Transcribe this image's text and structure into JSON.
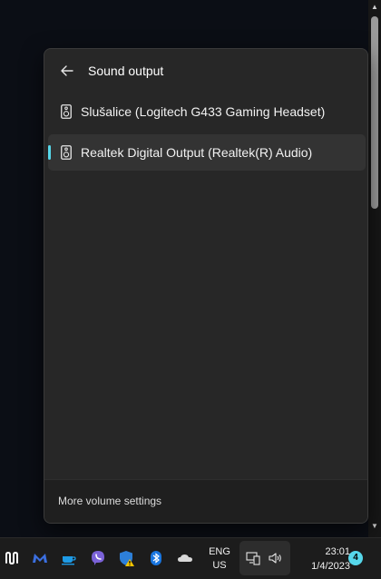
{
  "flyout": {
    "title": "Sound output",
    "devices": [
      {
        "label": "Slušalice (Logitech G433 Gaming Headset)",
        "selected": false
      },
      {
        "label": "Realtek Digital Output (Realtek(R) Audio)",
        "selected": true
      }
    ],
    "footer_link": "More volume settings",
    "accent_color": "#56d7ea"
  },
  "taskbar": {
    "pinned_icons": [
      "notion-icon",
      "malwarebytes-icon",
      "coffee-icon",
      "viber-icon",
      "windows-security-icon",
      "bluetooth-icon",
      "onedrive-icon"
    ],
    "language": {
      "line1": "ENG",
      "line2": "US"
    },
    "system_icons": [
      "network-icon",
      "speaker-icon"
    ],
    "clock": {
      "time": "23:01",
      "date": "1/4/2023"
    },
    "notification_count": "4"
  }
}
